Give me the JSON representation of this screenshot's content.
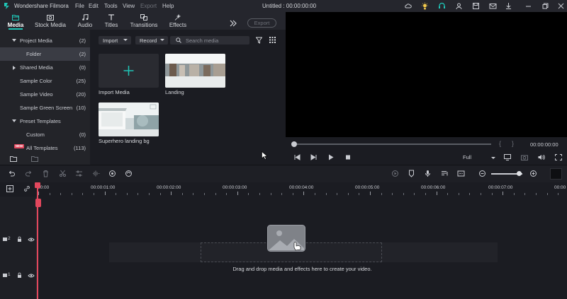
{
  "app": {
    "name": "Wondershare Filmora",
    "doc_title": "Untitled : 00:00:00:00"
  },
  "menu": [
    "File",
    "Edit",
    "Tools",
    "View",
    "Export",
    "Help"
  ],
  "tabs": [
    {
      "label": "Media",
      "icon": "media-icon",
      "active": true
    },
    {
      "label": "Stock Media",
      "icon": "stock-media-icon"
    },
    {
      "label": "Audio",
      "icon": "audio-icon"
    },
    {
      "label": "Titles",
      "icon": "titles-icon"
    },
    {
      "label": "Transitions",
      "icon": "transitions-icon"
    },
    {
      "label": "Effects",
      "icon": "effects-icon"
    }
  ],
  "export_label": "Export",
  "sidebar": {
    "items": [
      {
        "label": "Project Media",
        "count": "(2)",
        "expand": "down"
      },
      {
        "label": "Folder",
        "count": "(2)",
        "selected": true
      },
      {
        "label": "Shared Media",
        "count": "(0)",
        "expand": "right"
      },
      {
        "label": "Sample Color",
        "count": "(25)"
      },
      {
        "label": "Sample Video",
        "count": "(20)"
      },
      {
        "label": "Sample Green Screen",
        "count": "(10)"
      },
      {
        "label": "Preset Templates",
        "count": "",
        "expand": "down"
      },
      {
        "label": "Custom",
        "count": "(0)"
      },
      {
        "label": "All Templates",
        "count": "(113)",
        "badge": "NEW"
      }
    ]
  },
  "media": {
    "import_label": "Import",
    "record_label": "Record",
    "search_placeholder": "Search media",
    "items": [
      {
        "label": "Import Media",
        "kind": "import"
      },
      {
        "label": "Landing",
        "kind": "clip"
      },
      {
        "label": "Superhero landing bg",
        "kind": "clip"
      }
    ]
  },
  "player": {
    "timecode": "00:00:00:00",
    "quality": "Full",
    "bracket_in": "{",
    "bracket_out": "}"
  },
  "timeline": {
    "ruler": [
      "00:00",
      "00:00:01:00",
      "00:00:02:00",
      "00:00:03:00",
      "00:00:04:00",
      "00:00:05:00",
      "00:00:06:00",
      "00:00:07:00",
      "00:00"
    ],
    "tracks": [
      {
        "label": "2"
      },
      {
        "label": "1"
      }
    ],
    "drop_hint": "Drag and drop media and effects here to create your video."
  },
  "colors": {
    "accent": "#1fc6b7",
    "playhead": "#e2475d",
    "background": "#1b1c22"
  }
}
